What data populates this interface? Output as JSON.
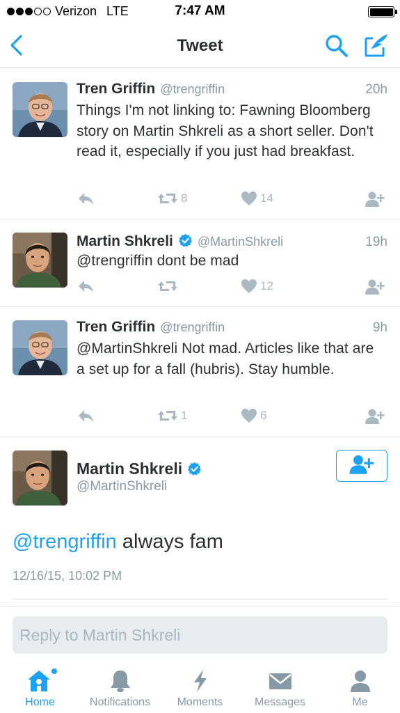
{
  "status_bar": {
    "carrier": "Verizon",
    "network": "LTE",
    "time": "7:47 AM",
    "signal_bars_filled": 3,
    "signal_bars_total": 5,
    "battery_level": 1.0
  },
  "nav": {
    "title": "Tweet",
    "back_icon": "chevron-left-icon",
    "search_icon": "search-icon",
    "compose_icon": "compose-tweet-icon"
  },
  "colors": {
    "accent": "#1da1f2",
    "text": "#292f33",
    "secondary": "#8899a6",
    "action": "#aab8c2",
    "divider": "#e1e8ed"
  },
  "tweets": [
    {
      "name": "Tren Griffin",
      "handle": "@trengriffin",
      "time": "20h",
      "verified": false,
      "text": "Things I'm not linking to: Fawning Bloomberg story on Martin Shkreli as a short seller. Don't read it, especially if you just had breakfast.",
      "retweets": "8",
      "likes": "14"
    },
    {
      "name": "Martin Shkreli",
      "handle": "@MartinShkreli",
      "time": "19h",
      "verified": true,
      "text": "@trengriffin dont be mad",
      "retweets": "",
      "likes": "12"
    },
    {
      "name": "Tren Griffin",
      "handle": "@trengriffin",
      "time": "9h",
      "verified": false,
      "text": "@MartinShkreli Not mad. Articles like that are a set up for a fall (hubris). Stay humble.",
      "retweets": "1",
      "likes": "6"
    }
  ],
  "focused": {
    "name": "Martin Shkreli",
    "handle": "@MartinShkreli",
    "verified": true,
    "mention": "@trengriffin",
    "text": " always fam",
    "date": "12/16/15, 10:02 PM",
    "follow_icon": "follow-user-icon"
  },
  "reply": {
    "placeholder": "Reply to Martin Shkreli"
  },
  "tabs": [
    {
      "label": "Home",
      "icon": "home-icon",
      "active": true,
      "has_badge": true
    },
    {
      "label": "Notifications",
      "icon": "bell-icon",
      "active": false
    },
    {
      "label": "Moments",
      "icon": "lightning-icon",
      "active": false
    },
    {
      "label": "Messages",
      "icon": "envelope-icon",
      "active": false
    },
    {
      "label": "Me",
      "icon": "person-icon",
      "active": false
    }
  ]
}
